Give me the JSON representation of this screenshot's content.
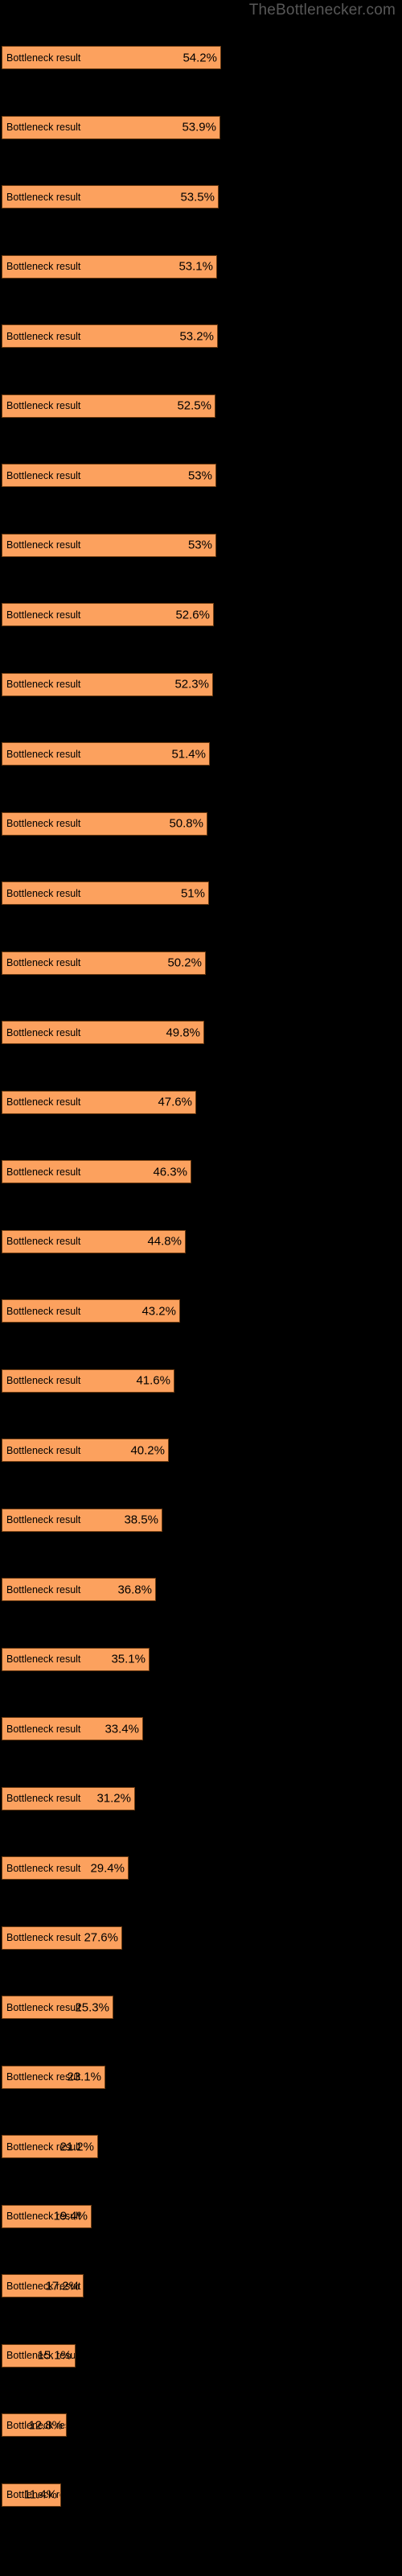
{
  "watermark": "TheBottlenecker.com",
  "chart_data": {
    "type": "bar",
    "orientation": "horizontal",
    "title": "",
    "xlabel": "",
    "ylabel": "",
    "grid": false,
    "legend": "none",
    "background_color": "#000000",
    "bar_color": "#fca15e",
    "bar_border_color": "#6b3a10",
    "text_color": "#000000",
    "xlim": [
      0,
      60
    ],
    "bar_label": "Bottleneck result",
    "value_suffix": "%",
    "categories": [
      "Bottleneck result",
      "Bottleneck result",
      "Bottleneck result",
      "Bottleneck result",
      "Bottleneck result",
      "Bottleneck result",
      "Bottleneck result",
      "Bottleneck result",
      "Bottleneck result",
      "Bottleneck result",
      "Bottleneck result",
      "Bottleneck result",
      "Bottleneck result",
      "Bottleneck result",
      "Bottleneck result",
      "Bottleneck result",
      "Bottleneck result",
      "Bottleneck result",
      "Bottleneck result",
      "Bottleneck result",
      "Bottleneck result",
      "Bottleneck result",
      "Bottleneck result",
      "Bottleneck result",
      "Bottleneck result",
      "Bottleneck result",
      "Bottleneck result",
      "Bottleneck result",
      "Bottleneck result",
      "Bottleneck result",
      "Bottleneck result",
      "Bottleneck result",
      "Bottleneck result",
      "Bottleneck result",
      "Bottleneck result",
      "Bottleneck result"
    ],
    "values": [
      54.2,
      53.9,
      53.5,
      53.1,
      53.2,
      52.5,
      53,
      53,
      52.6,
      52.3,
      51.4,
      50.8,
      51,
      50.2,
      49.8,
      47.6,
      46.3,
      44.8,
      43.2,
      41.6,
      40.2,
      38.5,
      36.8,
      35.1,
      33.4,
      31.2,
      29.4,
      27.6,
      25.3,
      23.1,
      21.2,
      19.4,
      17.2,
      15.1,
      12.8,
      11.4
    ],
    "value_labels": [
      "54.2%",
      "53.9%",
      "53.5%",
      "53.1%",
      "53.2%",
      "52.5%",
      "53%",
      "53%",
      "52.6%",
      "52.3%",
      "51.4%",
      "50.8%",
      "51%",
      "50.2%",
      "49.8%",
      "47.6%",
      "46.3%",
      "44.8%",
      "43.2%",
      "41.6%",
      "40.2%",
      "38.5%",
      "36.8%",
      "35.1%",
      "33.4%",
      "31.2%",
      "29.4%",
      "27.6%",
      "25.3%",
      "23.1%",
      "21.2%",
      "19.4%",
      "17.2%",
      "15.1%",
      "12.8%",
      "11.4%"
    ],
    "bar_pixel_widths": [
      273,
      272,
      270,
      268,
      269,
      266,
      267,
      267,
      264,
      263,
      259,
      256,
      258,
      254,
      252,
      242,
      236,
      229,
      222,
      215,
      208,
      200,
      192,
      184,
      176,
      166,
      158,
      150,
      139,
      129,
      120,
      112,
      102,
      92,
      81,
      74
    ]
  }
}
